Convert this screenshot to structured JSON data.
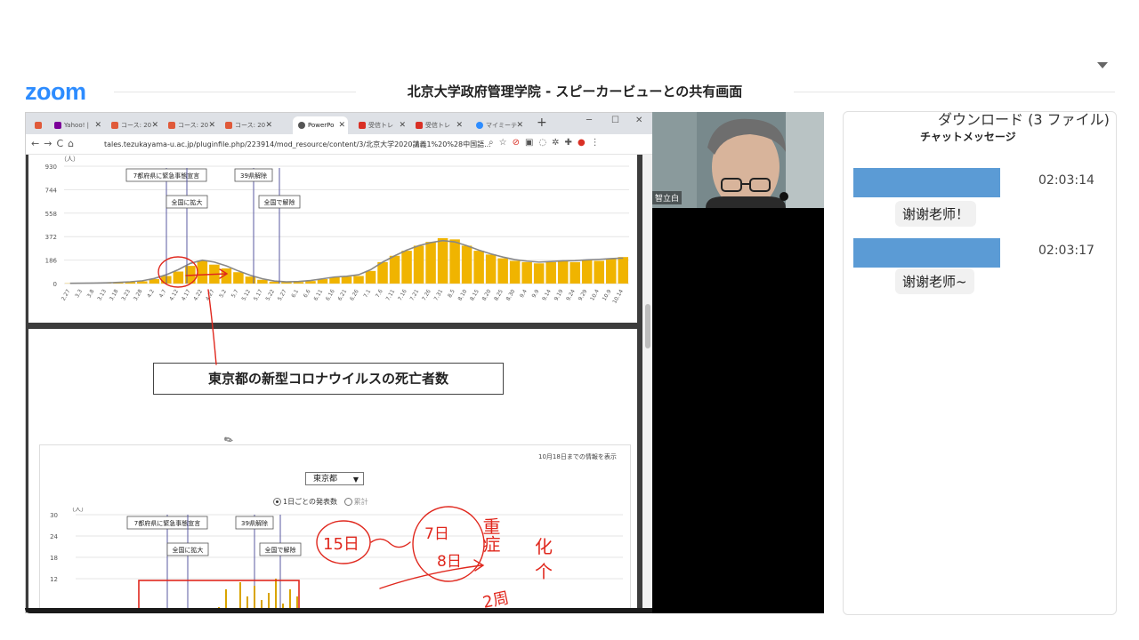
{
  "meeting": {
    "title": "北京大学政府管理学院 - スピーカービューとの共有画面"
  },
  "logo": {
    "text": "zoom",
    "color": "#2d8cff"
  },
  "browser": {
    "tabs": [
      {
        "label": "",
        "icon": "rss-icon",
        "color": "#e05a3a"
      },
      {
        "label": "Yahoo! |",
        "icon": "yahoo-icon",
        "color": "#7b0099"
      },
      {
        "label": "コース: 20",
        "icon": "course-icon",
        "color": "#e05a3a"
      },
      {
        "label": "コース: 20",
        "icon": "course-icon",
        "color": "#e05a3a"
      },
      {
        "label": "コース: 20",
        "icon": "course-icon",
        "color": "#e05a3a"
      },
      {
        "label": "PowerPo",
        "icon": "globe-icon",
        "color": "#555555"
      },
      {
        "label": "受信トレ",
        "icon": "gmail-icon",
        "color": "#d93025"
      },
      {
        "label": "受信トレ",
        "icon": "gmail-icon",
        "color": "#d93025"
      },
      {
        "label": "マイミーテ",
        "icon": "zoom-icon",
        "color": "#2d8cff"
      }
    ],
    "url": "tales.tezukayama-u.ac.jp/pluginfile.php/223914/mod_resource/content/3/北京大学2020講義1%20%28中国語..."
  },
  "chart_data": [
    {
      "type": "bar",
      "ylabel": "（人）",
      "ylim": [
        0,
        930
      ],
      "yticks": [
        0,
        186,
        372,
        558,
        744,
        930
      ],
      "annotations": [
        "7都府県に緊急事態宣言",
        "全国に拡大",
        "39県解除",
        "全国で解除"
      ],
      "xticks": [
        "2.27",
        "3.3",
        "3.8",
        "3.13",
        "3.18",
        "3.23",
        "3.28",
        "4.2",
        "4.7",
        "4.12",
        "4.17",
        "4.22",
        "4.27",
        "5.2",
        "5.7",
        "5.12",
        "5.17",
        "5.22",
        "5.27",
        "6.1",
        "6.6",
        "6.11",
        "6.16",
        "6.21",
        "6.26",
        "7.1",
        "7.6",
        "7.11",
        "7.16",
        "7.21",
        "7.26",
        "7.31",
        "8.5",
        "8.10",
        "8.15",
        "8.20",
        "8.25",
        "8.30",
        "9.4",
        "9.9",
        "9.14",
        "9.19",
        "9.24",
        "9.29",
        "10.4",
        "10.9",
        "10.14"
      ],
      "values": [
        2,
        3,
        4,
        5,
        8,
        12,
        18,
        35,
        60,
        95,
        140,
        180,
        150,
        120,
        90,
        55,
        30,
        15,
        10,
        12,
        20,
        35,
        50,
        55,
        60,
        100,
        170,
        220,
        260,
        300,
        330,
        360,
        350,
        300,
        260,
        230,
        200,
        180,
        170,
        160,
        170,
        180,
        170,
        190,
        180,
        200,
        210
      ],
      "trend": [
        2,
        3,
        4,
        6,
        9,
        14,
        22,
        40,
        70,
        110,
        160,
        185,
        170,
        140,
        100,
        65,
        38,
        20,
        14,
        16,
        24,
        38,
        52,
        58,
        70,
        110,
        170,
        220,
        265,
        300,
        325,
        340,
        330,
        300,
        265,
        235,
        210,
        190,
        178,
        170,
        175,
        180,
        182,
        188,
        192,
        198,
        202
      ]
    },
    {
      "type": "bar",
      "title": "東京都の新型コロナウイルスの死亡者数",
      "ylabel": "（人）",
      "ylim": [
        0,
        30
      ],
      "yticks": [
        12,
        18,
        24,
        30
      ],
      "annotations": [
        "7都府県に緊急事態宣言",
        "全国に拡大",
        "39県解除",
        "全国で解除"
      ],
      "values": [
        4,
        9,
        3,
        11,
        7,
        10,
        6,
        8,
        12,
        5,
        9,
        7
      ]
    }
  ],
  "chart2": {
    "note": "10月18日までの情報を表示",
    "region_select": "東京都",
    "radio_daily": "1日ごとの発表数",
    "radio_cumulative": "累計"
  },
  "handwriting": {
    "text1": "15日",
    "text2": "7日",
    "text3": "8日",
    "text4": "重症",
    "text5": "化",
    "text6": "个",
    "text7": "2周",
    "color": "#e0281e"
  },
  "video": {
    "name": "智立白"
  },
  "chat": {
    "download_label": "ダウンロード (3 ファイル)",
    "title": "チャットメッセージ",
    "sender_color": "#5b9bd5",
    "messages": [
      {
        "time": "02:03:14",
        "text": "谢谢老师！"
      },
      {
        "time": "02:03:17",
        "text": "谢谢老师~"
      }
    ]
  }
}
